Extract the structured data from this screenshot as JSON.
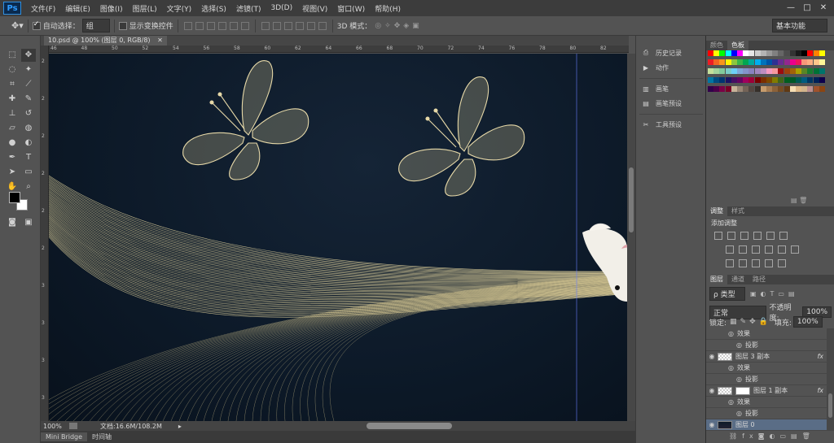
{
  "app": {
    "logo": "Ps"
  },
  "menu": [
    "文件(F)",
    "编辑(E)",
    "图像(I)",
    "图层(L)",
    "文字(Y)",
    "选择(S)",
    "滤镜(T)",
    "3D(D)",
    "视图(V)",
    "窗口(W)",
    "帮助(H)"
  ],
  "window_controls": [
    "—",
    "□",
    "✕"
  ],
  "options": {
    "auto_select_label": "自动选择：",
    "auto_select_value": "组",
    "transform_controls_label": "显示变换控件",
    "mode_3d_label": "3D 模式：",
    "workspace": "基本功能"
  },
  "document": {
    "tab_title": "10.psd @ 100% (图层 0, RGB/8)",
    "zoom": "100%",
    "doc_info": "文档:16.6M/108.2M",
    "ruler_top": [
      "46",
      "48",
      "50",
      "52",
      "54",
      "56",
      "58",
      "60",
      "62",
      "64",
      "66",
      "68",
      "70",
      "72",
      "74",
      "76",
      "78",
      "80",
      "82"
    ],
    "ruler_left": [
      "2",
      "2",
      "2",
      "2",
      "2",
      "2",
      "3",
      "3",
      "3",
      "3"
    ]
  },
  "bottom_tabs": [
    "Mini Bridge",
    "时间轴"
  ],
  "mid_panel": {
    "items": [
      {
        "icon": "history-icon",
        "label": "历史记录"
      },
      {
        "icon": "play-icon",
        "label": "动作"
      },
      {
        "icon": "brush-icon",
        "label": "画笔"
      },
      {
        "icon": "brush-preset-icon",
        "label": "画笔预设"
      },
      {
        "icon": "tool-preset-icon",
        "label": "工具预设"
      }
    ]
  },
  "color_panel": {
    "tabs": [
      "颜色",
      "色板"
    ],
    "active": 1
  },
  "adjustments_panel": {
    "tabs": [
      "调整",
      "样式"
    ],
    "title": "添加调整"
  },
  "layers_panel": {
    "tabs": [
      "图层",
      "通道",
      "路径"
    ],
    "kind_filter": "ρ 类型",
    "blend_mode": "正常",
    "opacity_label": "不透明度:",
    "opacity": "100%",
    "lock_label": "锁定:",
    "fill_label": "填充:",
    "fill": "100%",
    "rows": [
      {
        "type": "effect",
        "label": "效果"
      },
      {
        "type": "effect-item",
        "label": "投影"
      },
      {
        "type": "layer",
        "label": "图层 3 副本",
        "fx": "fx"
      },
      {
        "type": "effect",
        "label": "效果"
      },
      {
        "type": "effect-item",
        "label": "投影"
      },
      {
        "type": "layer-mask",
        "label": "图层 1 副本",
        "fx": "fx"
      },
      {
        "type": "effect",
        "label": "效果"
      },
      {
        "type": "effect-item",
        "label": "投影"
      },
      {
        "type": "layer-selected",
        "label": "图层 0"
      }
    ]
  },
  "colors": {
    "ui_dark": "#3c3c3c",
    "ui_mid": "#535353",
    "line_gold": "#e8d8a0",
    "canvas": "#0d1a29"
  }
}
